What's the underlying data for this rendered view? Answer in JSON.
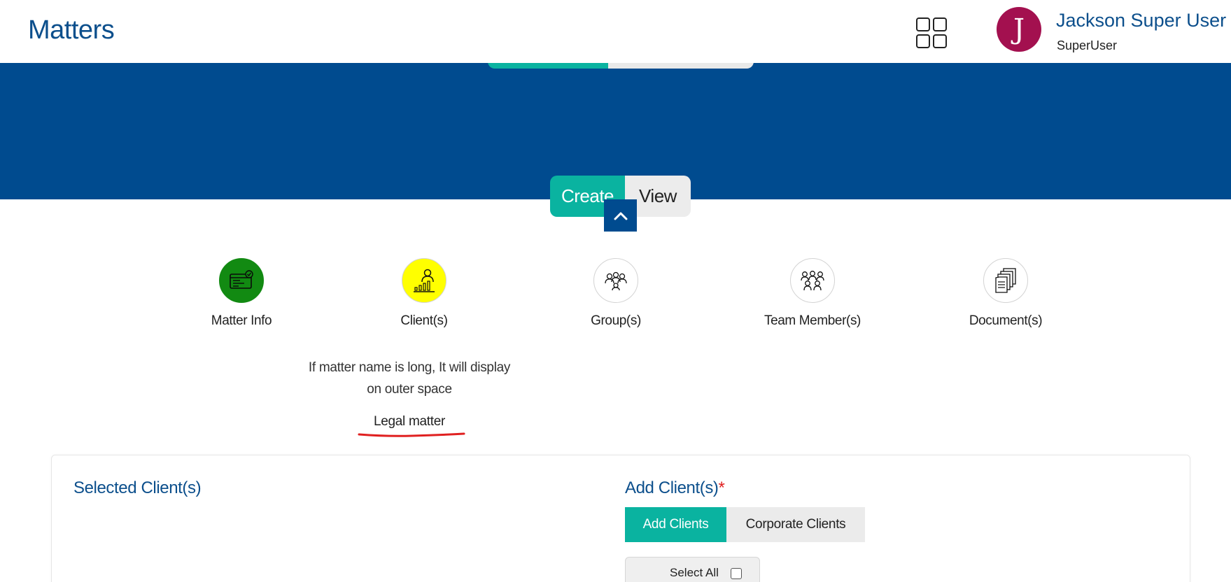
{
  "header": {
    "app_title": "Matters",
    "grid_icon": "apps-grid-icon",
    "avatar_initial": "J",
    "user_name": "Jackson Super User",
    "user_role": "SuperUser"
  },
  "banner": {
    "create_label": "Create",
    "view_label": "View",
    "collapse_icon": "chevron-up-icon"
  },
  "steps": [
    {
      "label": "Matter Info",
      "icon": "matter-info-icon",
      "status": "completed",
      "color": "#128a12"
    },
    {
      "label": "Client(s)",
      "icon": "client-icon",
      "status": "current",
      "color": "#ffff00"
    },
    {
      "label": "Group(s)",
      "icon": "group-icon",
      "status": "pending",
      "color": "#ffffff"
    },
    {
      "label": "Team Member(s)",
      "icon": "team-icon",
      "status": "pending",
      "color": "#ffffff"
    },
    {
      "label": "Document(s)",
      "icon": "document-icon",
      "status": "pending",
      "color": "#ffffff"
    }
  ],
  "note": {
    "line1": "If matter name is long, It will display",
    "line2": "on outer space",
    "matter_name": "Legal matter"
  },
  "clients": {
    "selected_title": "Selected Client(s)",
    "add_title": "Add Client(s)",
    "required_mark": "*",
    "tabs": [
      {
        "label": "Add Clients",
        "active": true
      },
      {
        "label": "Corporate Clients",
        "active": false
      }
    ],
    "select_all_label": "Select All",
    "select_all_checked": false
  },
  "colors": {
    "brand_blue": "#004b8f",
    "title_blue": "#0c4f8c",
    "accent_teal": "#0ab3a0",
    "avatar": "#a3104f",
    "underline_red": "#e02020"
  }
}
